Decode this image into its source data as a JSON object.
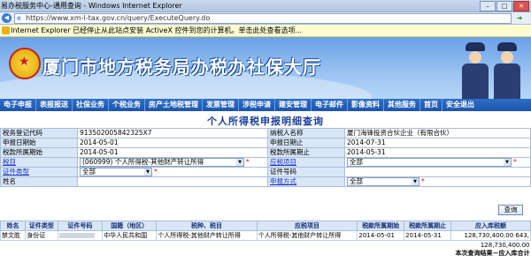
{
  "window": {
    "title": "易办税服务中心-通用查询 - Windows Internet Explorer"
  },
  "address": {
    "url": "https://www.xm-l-tax.gov.cn/query/ExecuteQuery.do"
  },
  "infobar": {
    "text": "Internet Explorer 已经停止从此站点安装 ActiveX 控件到您的计算机。单击此处查看选项..."
  },
  "banner": {
    "title": "厦门市地方税务局办税办社保大厅"
  },
  "menu": [
    "电子申报",
    "表报报送",
    "社保业务",
    "个税业务",
    "房产土地税管理",
    "发票管理",
    "涉税申请",
    "建安管理",
    "电子邮件",
    "影像资料",
    "其他服务",
    "首页",
    "安全退出"
  ],
  "page_title": "个人所得税申报明细查询",
  "form": {
    "rows": [
      {
        "l1": "税务登记代码",
        "v1": "913502005842325X7",
        "l2": "纳税人名称",
        "v2": "厦门海锋投资合伙企业（有限合伙）"
      },
      {
        "l1": "申报日期始",
        "v1": "2014-05-01",
        "l2": "申报日期止",
        "v2": "2014-07-31"
      },
      {
        "l1": "税款所属期始",
        "v1": "2014-05-01",
        "l2": "税款所属期止",
        "v2": "2014-05-31"
      }
    ],
    "tax_label": "税目",
    "tax_value": "(060999) 个人所得税-其他财产转让所得",
    "item_label": "应税项目",
    "item_value": "全部",
    "idtype_label": "证件类型",
    "idtype_value": "全部",
    "idno_label": "证件号码",
    "name_label": "姓名",
    "method_label": "申报方式",
    "method_value": "全部",
    "required_mark": "*"
  },
  "query_button": "查询",
  "results": {
    "headers": [
      "姓名",
      "证件类型",
      "证件号码",
      "国籍（地区）",
      "税种、税目",
      "应税项目",
      "税款所属期始",
      "税款所属期止",
      "应入库税额"
    ],
    "rows": [
      [
        "禁文胜",
        "身份证",
        "",
        "中华人民共和国",
        "个人所得税-其他财产转让所得",
        "个人所得税-其他财产转让所得",
        "2014-05-01",
        "2014-05-31",
        "128,730,400.00 643,"
      ]
    ],
    "total_value": "128,730,400.00",
    "summary_label": "本次查询结果－应入库合计"
  }
}
